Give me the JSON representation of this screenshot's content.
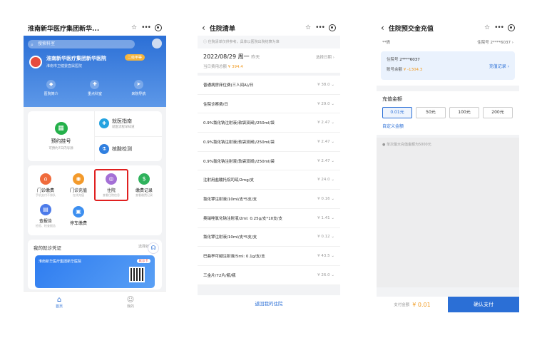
{
  "screen1": {
    "title": "淮南新华医疗集团新华...",
    "search_placeholder": "搜索科室",
    "hospital_name": "淮南新华医疗集团新华医院",
    "tag": "二级甲等",
    "hospital_sub": "淮南市卫健委直属医院",
    "quick": [
      {
        "label": "医院简介",
        "icon": "◆"
      },
      {
        "label": "重点科室",
        "icon": "✚"
      },
      {
        "label": "来院导航",
        "icon": "➤"
      }
    ],
    "booking": {
      "label": "预约挂号",
      "sub": "可预约7日内号源"
    },
    "guide": {
      "label": "就医指南",
      "sub": "就医流程早知道"
    },
    "check": {
      "label": "核酸检测"
    },
    "services": [
      {
        "label": "门诊缴费",
        "sub": "手机支付不排队",
        "color": "#f06b3c",
        "icon": "⌂"
      },
      {
        "label": "门诊充值",
        "sub": "在线充值",
        "color": "#f39a2b",
        "icon": "◉"
      },
      {
        "label": "住院",
        "sub": "查看住院信息",
        "color": "#a46fd6",
        "icon": "◎"
      },
      {
        "label": "缴费记录",
        "sub": "查看缴费记录",
        "color": "#2fb25c",
        "icon": "$"
      },
      {
        "label": "查报告",
        "sub": "检验、检查报告",
        "color": "#4c7bea",
        "icon": "▤"
      },
      {
        "label": "停车缴费",
        "sub": "",
        "color": "#3d8ff0",
        "icon": "▣"
      }
    ],
    "voucher": {
      "title": "我的就诊凭证",
      "switch": "选择就诊人",
      "card_title": "淮南新华医疗集团新华医院",
      "badge": "就诊卡"
    },
    "tabs": [
      {
        "label": "首页"
      },
      {
        "label": "我的"
      }
    ]
  },
  "screen2": {
    "title": "住院清单",
    "notice": "住院清单仅供参考，具体以医院出院结算为准",
    "date": "2022/08/29 周一",
    "date_rel": "昨天",
    "select_date": "选择日期 ›",
    "total_label": "当日费用总额",
    "total": "¥ 394.4",
    "items": [
      {
        "name": "普通病房床位费(三人间A)/日",
        "price": "¥ 38.0"
      },
      {
        "name": "住院诊察费/日",
        "price": "¥ 29.0"
      },
      {
        "name": "0.9%氯化钠注射液(软袋双阀)/250ml/袋",
        "price": "¥ 2.47"
      },
      {
        "name": "0.9%氯化钠注射液(软袋双阀)/250ml/袋",
        "price": "¥ 2.47"
      },
      {
        "name": "0.9%氯化钠注射液(软袋双阀)/250ml/袋",
        "price": "¥ 2.47"
      },
      {
        "name": "注射用盐酸托烷司琼/2mg/支",
        "price": "¥ 24.0"
      },
      {
        "name": "氯化钾注射液/10ml/支*5支/支",
        "price": "¥ 0.16"
      },
      {
        "name": "奥硝唑氯化钠注射液/2ml: 0.25g/支*10支/支",
        "price": "¥ 1.41"
      },
      {
        "name": "氯化钾注射液/10ml/支*5支/支",
        "price": "¥ 0.12"
      },
      {
        "name": "巴曲亭可碱注射液/5ml: 0.1g/支/支",
        "price": "¥ 43.5"
      },
      {
        "name": "三金片/72片/瓶/瓶",
        "price": "¥ 26.0"
      }
    ],
    "footer": "返回我的住院"
  },
  "screen3": {
    "title": "住院预交金充值",
    "user": "**倩",
    "user_no": "住院号 2****6037 ›",
    "acct_no_label": "住院号",
    "acct_no": "2****6037",
    "balance_label": "账号余额",
    "balance": "¥ -1304.3",
    "record": "充值记录 ›",
    "amount_title": "充值金额",
    "chips": [
      "0.01元",
      "50元",
      "100元",
      "200元"
    ],
    "custom": "自定义金额",
    "hint": "单次最大充值金额为5000元",
    "pay_label": "支付金额",
    "pay_amount": "¥ 0.01",
    "pay_button": "确认支付"
  }
}
